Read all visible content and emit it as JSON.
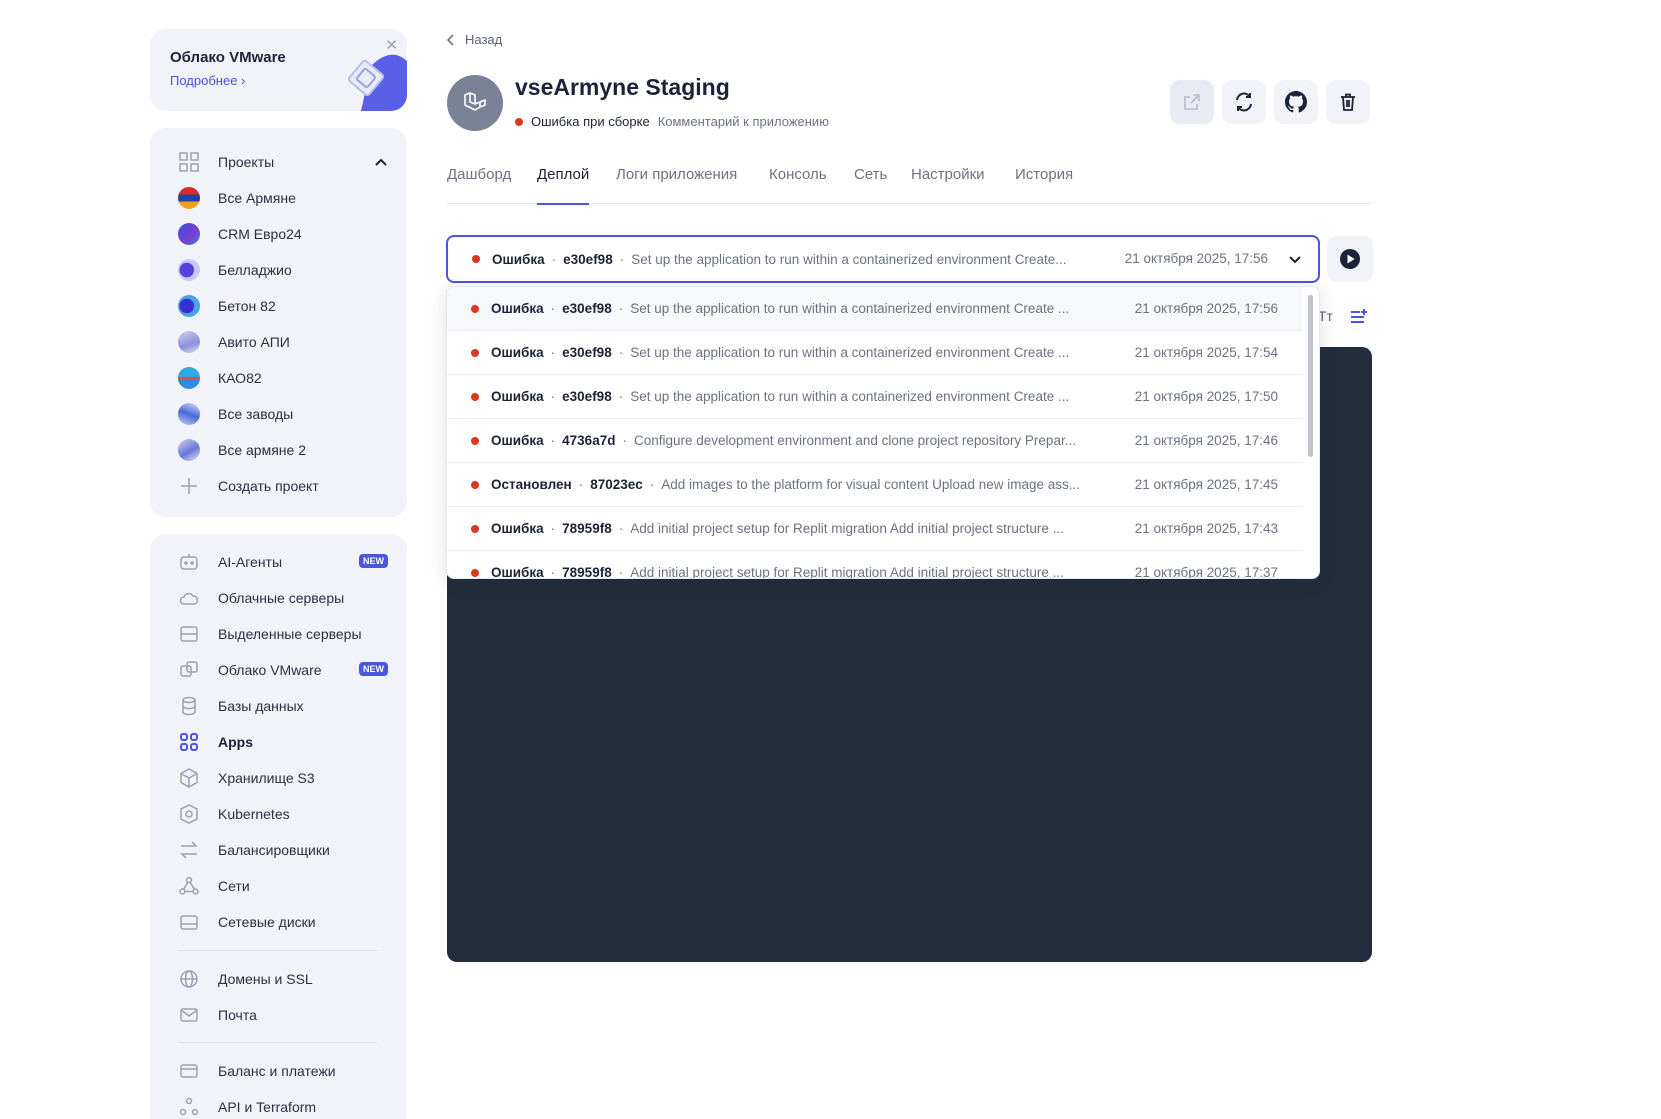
{
  "promo": {
    "title": "Облако VMware",
    "link": "Подробнее"
  },
  "sidebar": {
    "projects_header": "Проекты",
    "projects": [
      {
        "label": "Все Армяне"
      },
      {
        "label": "CRM Евро24"
      },
      {
        "label": "Белладжио"
      },
      {
        "label": "Бетон 82"
      },
      {
        "label": "Авито АПИ"
      },
      {
        "label": "КАО82"
      },
      {
        "label": "Все заводы"
      },
      {
        "label": "Все армяне 2"
      },
      {
        "label": "Создать проект"
      }
    ],
    "services": [
      {
        "label": "AI-Агенты",
        "badge": "NEW"
      },
      {
        "label": "Облачные серверы"
      },
      {
        "label": "Выделенные серверы"
      },
      {
        "label": "Облако VMware",
        "badge": "NEW"
      },
      {
        "label": "Базы данных"
      },
      {
        "label": "Apps"
      },
      {
        "label": "Хранилище S3"
      },
      {
        "label": "Kubernetes"
      },
      {
        "label": "Балансировщики"
      },
      {
        "label": "Сети"
      },
      {
        "label": "Сетевые диски"
      },
      {
        "label": "Домены и SSL"
      },
      {
        "label": "Почта"
      },
      {
        "label": "Баланс и платежи"
      },
      {
        "label": "API и Terraform"
      }
    ]
  },
  "header": {
    "back": "Назад",
    "title": "vseArmyne Staging",
    "status": "Ошибка при сборке",
    "comment": "Комментарий к приложению"
  },
  "tabs": [
    "Дашборд",
    "Деплой",
    "Логи приложения",
    "Консоль",
    "Сеть",
    "Настройки",
    "История"
  ],
  "toolbar": {
    "font_toggle": "Тт"
  },
  "selected_deploy": {
    "status": "Ошибка",
    "hash": "e30ef98",
    "message": "Set up the application to run within a containerized environment Create...",
    "date": "21 октября 2025, 17:56"
  },
  "deploys": [
    {
      "status": "Ошибка",
      "hash": "e30ef98",
      "message": "Set up the application to run within a containerized environment Create ...",
      "date": "21 октября 2025, 17:56"
    },
    {
      "status": "Ошибка",
      "hash": "e30ef98",
      "message": "Set up the application to run within a containerized environment Create ...",
      "date": "21 октября 2025, 17:54"
    },
    {
      "status": "Ошибка",
      "hash": "e30ef98",
      "message": "Set up the application to run within a containerized environment Create ...",
      "date": "21 октября 2025, 17:50"
    },
    {
      "status": "Ошибка",
      "hash": "4736a7d",
      "message": "Configure development environment and clone project repository Prepar...",
      "date": "21 октября 2025, 17:46"
    },
    {
      "status": "Остановлен",
      "hash": "87023ec",
      "message": "Add images to the platform for visual content Upload new image ass...",
      "date": "21 октября 2025, 17:45"
    },
    {
      "status": "Ошибка",
      "hash": "78959f8",
      "message": "Add initial project setup for Replit migration Add initial project structure ...",
      "date": "21 октября 2025, 17:43"
    },
    {
      "status": "Ошибка",
      "hash": "78959f8",
      "message": "Add initial project setup for Replit migration Add initial project structure ...",
      "date": "21 октября 2025, 17:37"
    }
  ],
  "colors": {
    "accent": "#4a55e0",
    "error": "#d93a1f",
    "console_bg": "#232d3b"
  }
}
